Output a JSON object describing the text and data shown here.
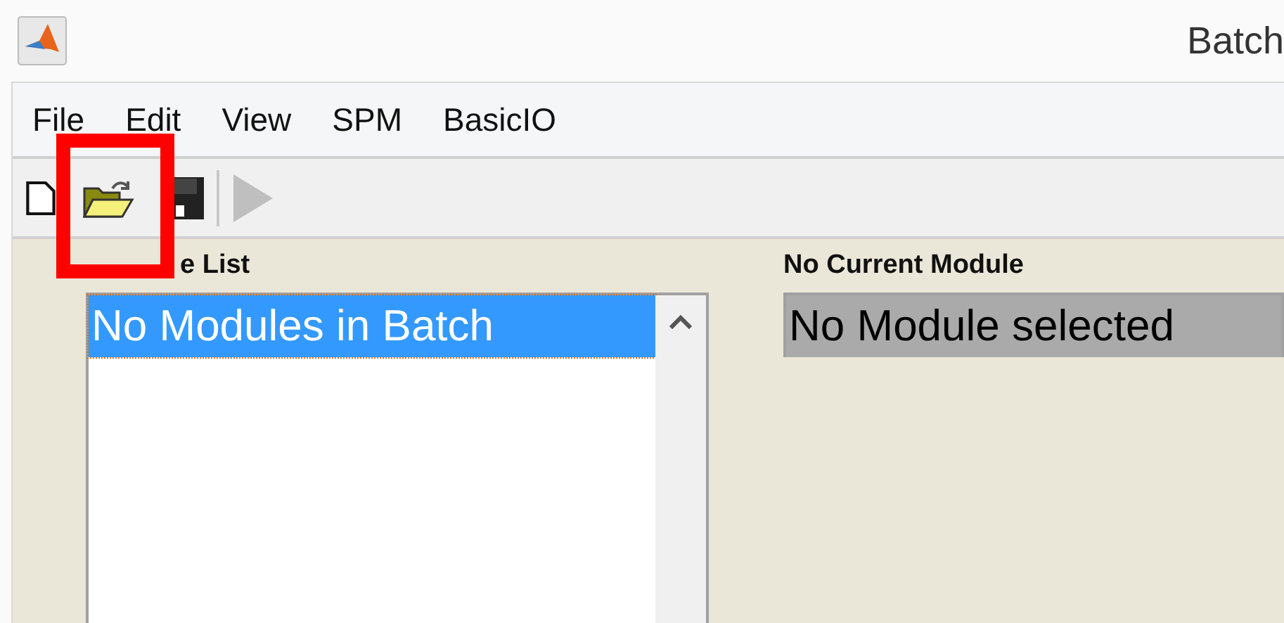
{
  "window": {
    "title": "Batch"
  },
  "menu": [
    "File",
    "Edit",
    "View",
    "SPM",
    "BasicIO"
  ],
  "toolbar": [
    {
      "kind": "new",
      "disabled": false
    },
    {
      "kind": "open",
      "disabled": false
    },
    {
      "kind": "save",
      "disabled": false
    },
    {
      "kind": "run",
      "disabled": true
    }
  ],
  "annotation": {
    "kind": "frame"
  },
  "module_list": {
    "label": "e List",
    "focused": true,
    "items": [
      {
        "text": "No Modules in Batch",
        "selected": true
      }
    ]
  },
  "current_module": {
    "label": "No Current Module",
    "focused": false,
    "items": [
      {
        "text": "No Module selected",
        "selected": true
      }
    ]
  }
}
